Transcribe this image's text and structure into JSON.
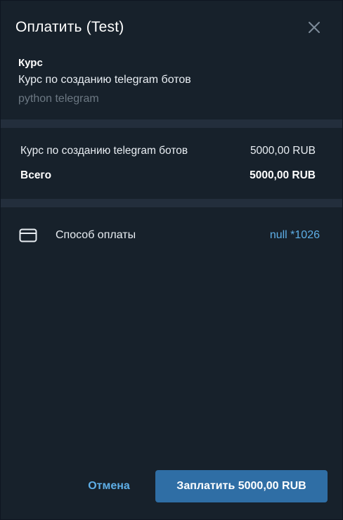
{
  "dialog": {
    "title": "Оплатить (Test)",
    "close_icon": "close-icon"
  },
  "product": {
    "name": "Курс",
    "description": "Курс по созданию telegram ботов",
    "meta": "python telegram"
  },
  "prices": {
    "items": [
      {
        "label": "Курс по созданию telegram ботов",
        "amount": "5000,00 RUB"
      }
    ],
    "total_label": "Всего",
    "total_amount": "5000,00 RUB"
  },
  "payment_method": {
    "icon": "credit-card-icon",
    "label": "Способ оплаты",
    "value": "null *1026"
  },
  "footer": {
    "cancel_label": "Отмена",
    "pay_label": "Заплатить 5000,00 RUB"
  },
  "colors": {
    "background": "#17212b",
    "separator": "#232e3c",
    "accent": "#5eaee6",
    "primary_button": "#2f6ea5",
    "muted_text": "#6c7883"
  }
}
